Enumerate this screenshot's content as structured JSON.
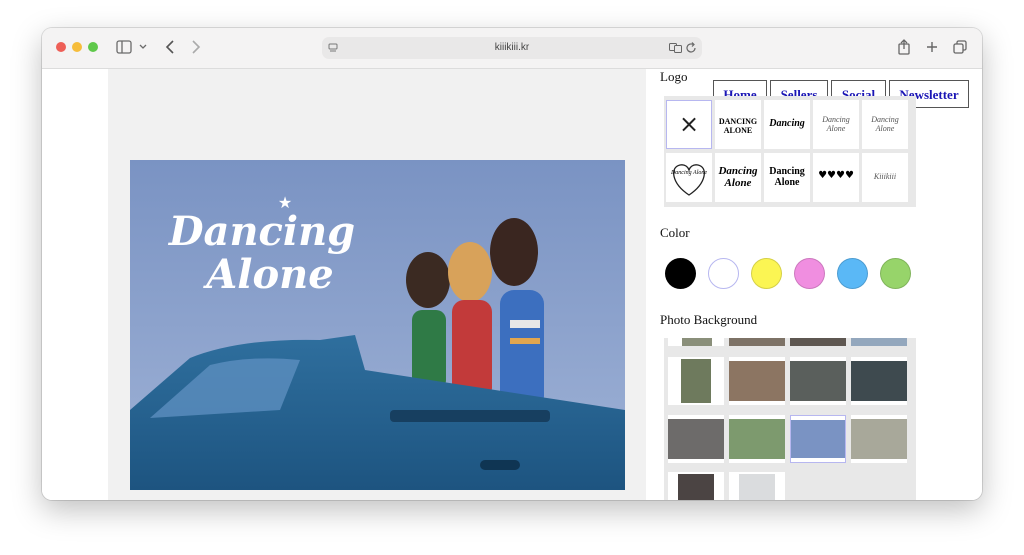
{
  "browser": {
    "url": "kiiikiii.kr"
  },
  "nav": {
    "home": "Home",
    "sellers": "Sellers",
    "social": "Social",
    "newsletter": "Newsletter"
  },
  "sections": {
    "logo": "Logo",
    "color": "Color",
    "photo_background": "Photo Background"
  },
  "photo": {
    "logo_line1": "Dancing",
    "logo_line2": "Alone"
  },
  "logo_options": {
    "none_symbol": "×",
    "items": [
      "DANCING ALONE",
      "Dancing",
      "Dancing Alone",
      "Dancing Alone",
      "Dancing Alone",
      "Dancing Alone",
      "Dancing Alone",
      "♥♥♥♥",
      "Kiiikiii"
    ]
  },
  "colors": {
    "swatches": [
      "#000000",
      "#ffffff",
      "#fbf553",
      "#f08ee0",
      "#5ab8f6",
      "#97d46a"
    ],
    "accent_link": "#1a15b5"
  },
  "icons": [
    "sidebar-toggle-icon",
    "chevron-down-icon",
    "back-arrow-icon",
    "forward-arrow-icon",
    "page-icon",
    "translate-icon",
    "reload-icon",
    "share-icon",
    "new-tab-icon",
    "tabs-overview-icon",
    "close-icon"
  ]
}
